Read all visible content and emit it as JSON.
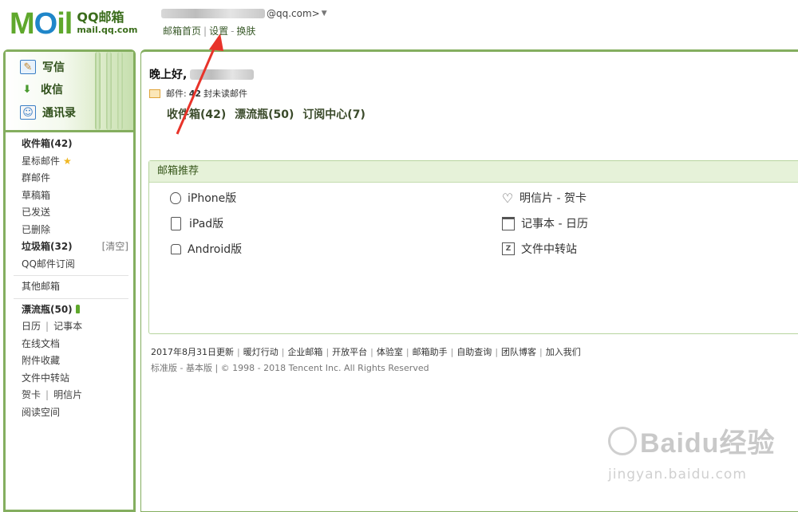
{
  "header": {
    "logo_main": "MOil",
    "logo_title": "QQ邮箱",
    "logo_domain": "mail.qq.com",
    "account_suffix": "@qq.com>",
    "links": [
      "邮箱首页",
      "设置",
      "换肤"
    ]
  },
  "sidebar": {
    "actions": [
      "写信",
      "收信",
      "通讯录"
    ],
    "folders": [
      {
        "label": "收件箱(42)",
        "bold": true
      },
      {
        "label": "星标邮件"
      },
      {
        "label": "群邮件"
      },
      {
        "label": "草稿箱"
      },
      {
        "label": "已发送"
      },
      {
        "label": "已删除"
      },
      {
        "label": "垃圾箱(32)",
        "bold": true,
        "extra": "[清空]"
      },
      {
        "label": "QQ邮件订阅"
      }
    ],
    "other_mail": "其他邮箱",
    "apps": {
      "bottle": "漂流瓶(50)",
      "calendar": "日历",
      "notebook": "记事本",
      "docs": "在线文档",
      "attachments": "附件收藏",
      "transfer": "文件中转站",
      "cards": "贺卡",
      "postcard": "明信片",
      "reading": "阅读空间"
    }
  },
  "main": {
    "greeting": "晚上好,",
    "unread_prefix": "邮件:",
    "unread_count": "42",
    "unread_suffix": "封未读邮件",
    "quick_links": [
      "收件箱(42)",
      "漂流瓶(50)",
      "订阅中心(7)"
    ],
    "recommend": {
      "title": "邮箱推荐",
      "left": [
        {
          "icon": "apple-icon",
          "label": "iPhone版"
        },
        {
          "icon": "ipad-icon",
          "label": "iPad版"
        },
        {
          "icon": "android-icon",
          "label": "Android版"
        }
      ],
      "right": [
        {
          "icon": "heart-icon",
          "label": "明信片 - 贺卡"
        },
        {
          "icon": "calendar-icon",
          "label": "记事本 - 日历"
        },
        {
          "icon": "file-transfer-icon",
          "label": "文件中转站"
        }
      ]
    },
    "footer_links": [
      "2017年8月31日更新",
      "暖灯行动",
      "企业邮箱",
      "开放平台",
      "体验室",
      "邮箱助手",
      "自助查询",
      "团队博客",
      "加入我们"
    ],
    "footer_version": "标准版 - 基本版 | © 1998 - 2018 Tencent Inc. All Rights Reserved"
  },
  "watermark": {
    "brand": "Baidu经验",
    "url": "jingyan.baidu.com"
  },
  "colors": {
    "frame_green": "#84ae5f",
    "header_green": "#e6f2d9",
    "arrow_red": "#e8332a"
  }
}
